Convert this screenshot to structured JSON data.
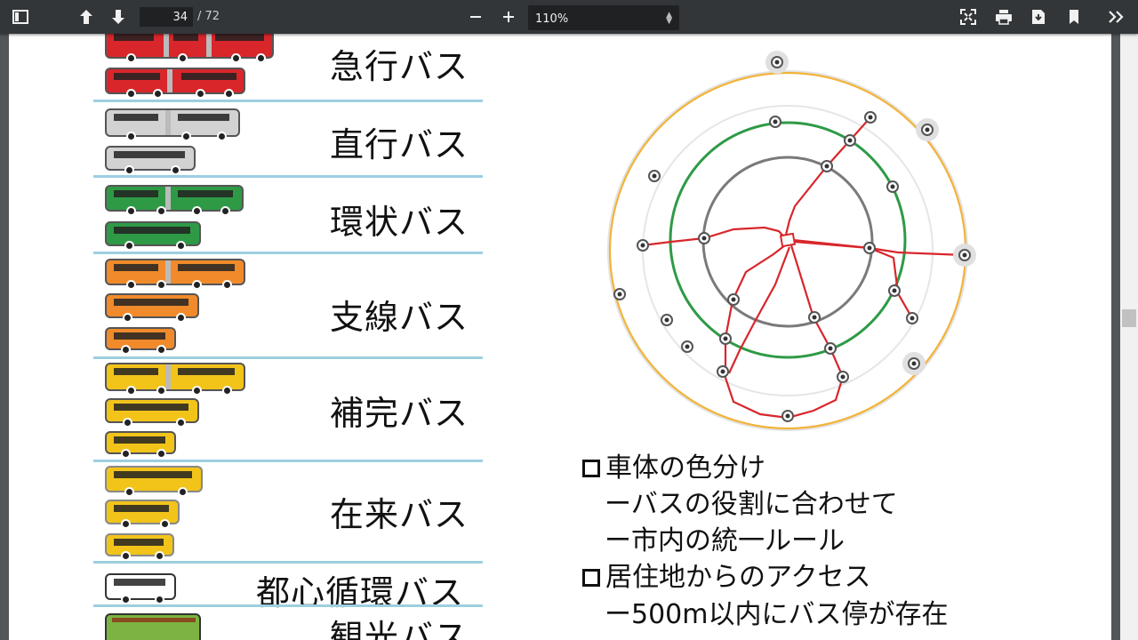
{
  "toolbar": {
    "page_current": "34",
    "page_total": "/ 72",
    "zoom": "110%",
    "icons": [
      "sidebar-icon",
      "arrow-up-icon",
      "arrow-down-icon",
      "minus-icon",
      "plus-icon",
      "fit-page-icon",
      "print-icon",
      "download-icon",
      "bookmark-icon",
      "more-icon"
    ]
  },
  "bus_types": [
    {
      "label": "急行バス",
      "color": "#d8262b"
    },
    {
      "label": "直行バス",
      "color": "#c8c8c8"
    },
    {
      "label": "環状バス",
      "color": "#2e9a46"
    },
    {
      "label": "支線バス",
      "color": "#f08a2a"
    },
    {
      "label": "補完バス",
      "color": "#f2c41a"
    },
    {
      "label": "在来バス",
      "color": "#f2c41a"
    },
    {
      "label": "都心循環バス",
      "color": "#ffffff"
    },
    {
      "label": "観光バス",
      "color": "#7cb342"
    }
  ],
  "notes": {
    "h1": "車体の色分け",
    "s1": "ーバスの役割に合わせて",
    "s2": "ー市内の統一ルール",
    "h2": "居住地からのアクセス",
    "s3": "ー500m以内にバス停が存在"
  },
  "colors": {
    "red_line": "#d8262b",
    "green_ring": "#2e9a46",
    "orange_ring": "#f2b33a",
    "gray_ring": "#7a7a7a",
    "separator": "#9ccfe0"
  }
}
